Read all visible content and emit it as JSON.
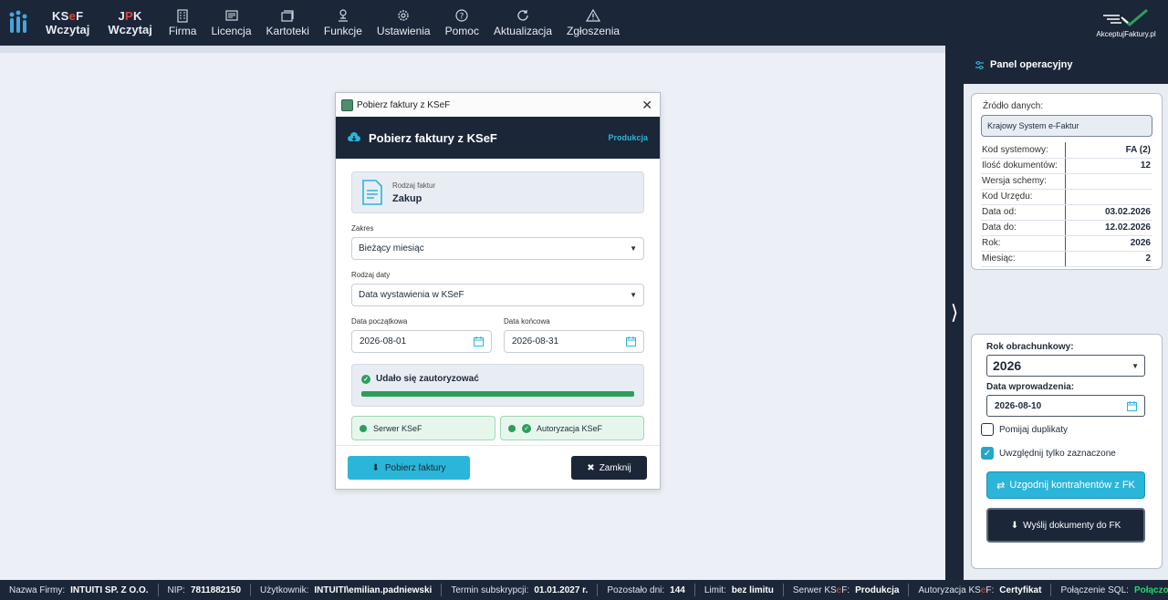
{
  "topbar": {
    "ksef_label_top_a": "KS",
    "ksef_label_top_b": "e",
    "ksef_label_top_c": "F",
    "ksef_label_bottom": "Wczytaj",
    "jpk_label_top_a": "J",
    "jpk_label_top_b": "P",
    "jpk_label_top_c": "K",
    "jpk_label_bottom": "Wczytaj",
    "items": [
      {
        "label": "Firma",
        "icon": "building-icon"
      },
      {
        "label": "Licencja",
        "icon": "license-icon"
      },
      {
        "label": "Kartoteki",
        "icon": "cards-icon"
      },
      {
        "label": "Funkcje",
        "icon": "functions-icon"
      },
      {
        "label": "Ustawienia",
        "icon": "gear-icon"
      },
      {
        "label": "Pomoc",
        "icon": "help-icon"
      },
      {
        "label": "Aktualizacja",
        "icon": "refresh-icon"
      },
      {
        "label": "Zgłoszenia",
        "icon": "warning-icon"
      }
    ],
    "brand_text": "AkceptujFaktury.pl"
  },
  "dialog": {
    "window_title": "Pobierz faktury z KSeF",
    "header_title": "Pobierz faktury z KSeF",
    "environment": "Produkcja",
    "type_label": "Rodzaj faktur",
    "type_value": "Zakup",
    "range_label": "Zakres",
    "range_value": "Bieżący miesiąc",
    "date_type_label": "Rodzaj daty",
    "date_type_value": "Data wystawienia w KSeF",
    "date_from_label": "Data początkowa",
    "date_from_value": "2026-08-01",
    "date_to_label": "Data końcowa",
    "date_to_value": "2026-08-31",
    "auth_message": "Udało się zautoryzować",
    "auth_progress": 1.0,
    "server_status": "Serwer KSeF",
    "auth_status": "Autoryzacja KSeF",
    "get_button": "Pobierz faktury",
    "close_button": "Zamknij"
  },
  "panel": {
    "title": "Panel operacyjny",
    "source_label": "Źródło danych:",
    "source_value": "Krajowy System e-Faktur",
    "rows": [
      {
        "k": "Kod systemowy:",
        "v": "FA (2)"
      },
      {
        "k": "Ilość dokumentów:",
        "v": "12"
      },
      {
        "k": "Wersja schemy:",
        "v": ""
      },
      {
        "k": "Kod Urzędu:",
        "v": ""
      },
      {
        "k": "Data od:",
        "v": "03.02.2026"
      },
      {
        "k": "Data do:",
        "v": "12.02.2026"
      },
      {
        "k": "Rok:",
        "v": "2026"
      },
      {
        "k": "Miesiąc:",
        "v": "2"
      }
    ],
    "fiscal_year_label": "Rok obrachunkowy:",
    "fiscal_year_value": "2026",
    "entry_date_label": "Data wprowadzenia:",
    "entry_date_value": "2026-08-10",
    "skip_duplicates_label": "Pomijaj duplikaty",
    "skip_duplicates_checked": false,
    "only_selected_label": "Uwzględnij tylko zaznaczone",
    "only_selected_checked": true,
    "match_button": "Uzgodnij kontrahentów z FK",
    "send_button": "Wyślij dokumenty do FK"
  },
  "statusbar": {
    "company_label": "Nazwa Firmy:",
    "company_value": "INTUITI SP. Z O.O.",
    "nip_label": "NIP:",
    "nip_value": "7811882150",
    "user_label": "Użytkownik:",
    "user_value": "INTUITI\\emilian.padniewski",
    "subscription_label": "Termin subskrypcji:",
    "subscription_value": "01.01.2027 r.",
    "days_label": "Pozostało dni:",
    "days_value": "144",
    "limit_label": "Limit:",
    "limit_value": "bez limitu",
    "server_label_a": "Serwer KS",
    "server_label_b": "e",
    "server_label_c": "F:",
    "server_value": "Produkcja",
    "auth_label_a": "Autoryzacja KS",
    "auth_label_b": "e",
    "auth_label_c": "F:",
    "auth_value": "Certyfikat",
    "sql_label": "Połączenie SQL:",
    "sql_value": "Połączono"
  },
  "colors": {
    "navy": "#1b2638",
    "accent_teal": "#2bb5d8",
    "success_green": "#2c9e5c",
    "brand_red": "#e0443b"
  }
}
